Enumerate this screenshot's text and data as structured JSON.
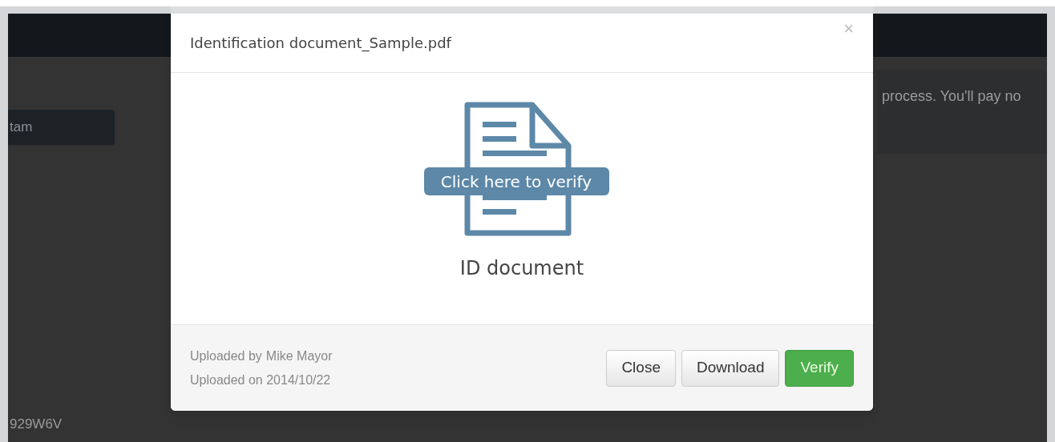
{
  "background": {
    "button_label": "tam",
    "notice": "process. You'll pay no",
    "code": "929W6V"
  },
  "dialog": {
    "title": "Identification document_Sample.pdf",
    "close_symbol": "×",
    "document_badge": "Click here to verify",
    "document_label": "ID document",
    "uploaded_by_label": "Uploaded by",
    "uploaded_by": "Mike Mayor",
    "uploaded_on": "Uploaded on 2014/10/22",
    "buttons": [
      {
        "label": "Close",
        "kind": "default"
      },
      {
        "label": "Download",
        "kind": "default"
      },
      {
        "label": "Verify",
        "kind": "success"
      }
    ]
  }
}
